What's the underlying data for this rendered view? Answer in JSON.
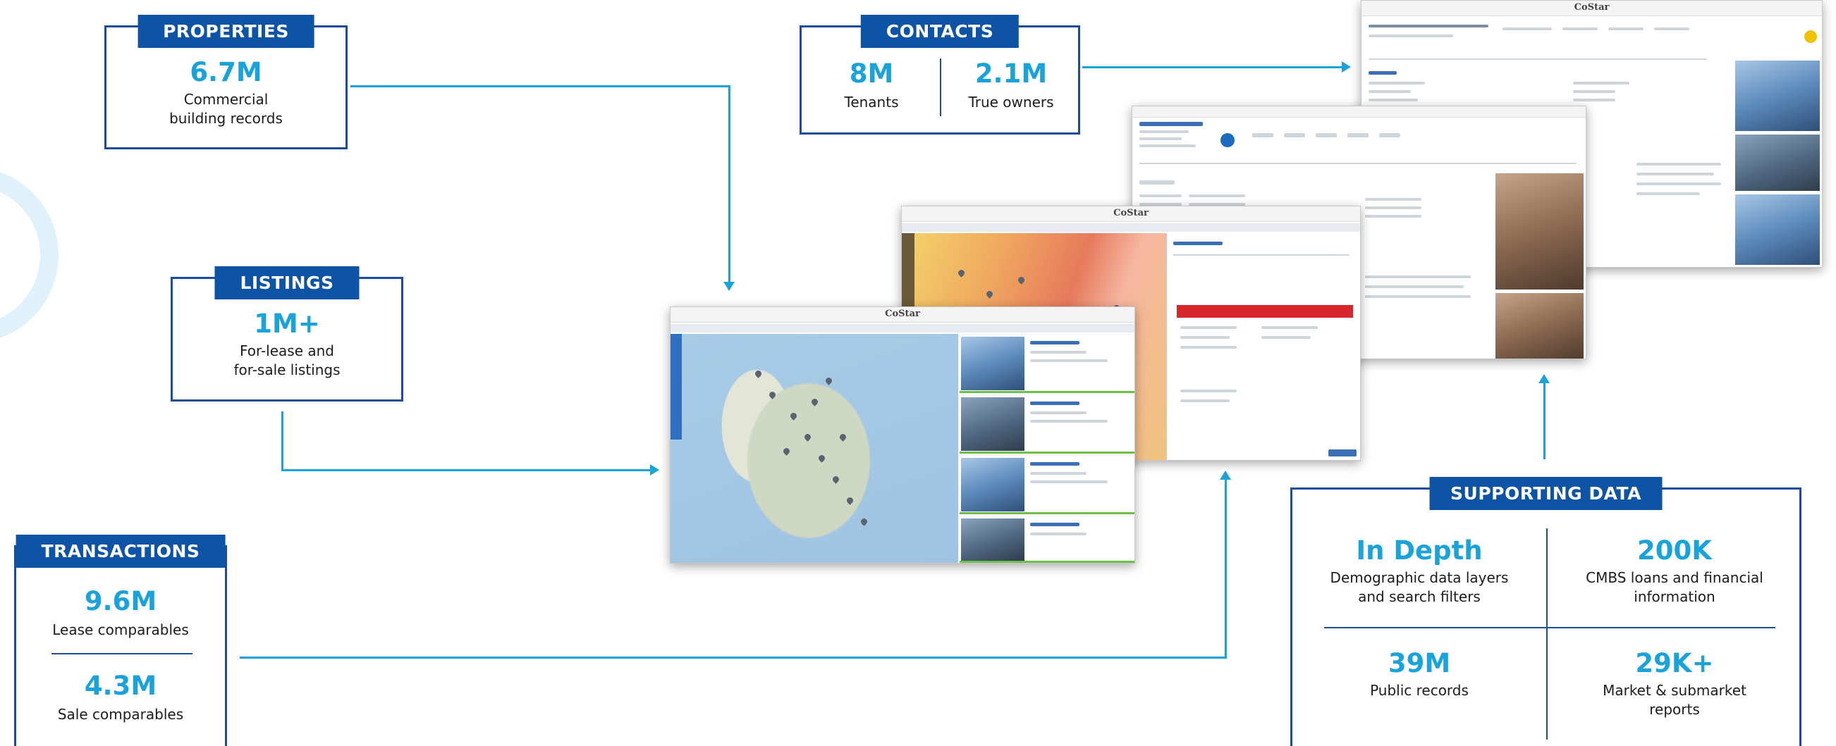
{
  "colors": {
    "tab_bg": "#0d53a6",
    "accent": "#1aa2da",
    "border": "#1b4f9c"
  },
  "properties": {
    "title": "PROPERTIES",
    "value": "6.7M",
    "label": "Commercial\nbuilding records"
  },
  "contacts": {
    "title": "CONTACTS",
    "items": [
      {
        "value": "8M",
        "label": "Tenants"
      },
      {
        "value": "2.1M",
        "label": "True owners"
      }
    ]
  },
  "listings": {
    "title": "LISTINGS",
    "value": "1M+",
    "label": "For-lease and\nfor-sale listings"
  },
  "transactions": {
    "title": "TRANSACTIONS",
    "items": [
      {
        "value": "9.6M",
        "label": "Lease comparables"
      },
      {
        "value": "4.3M",
        "label": "Sale comparables"
      }
    ]
  },
  "supporting": {
    "title": "SUPPORTING DATA",
    "items": [
      {
        "value": "In Depth",
        "label": "Demographic data layers\nand search filters"
      },
      {
        "value": "200K",
        "label": "CMBS loans and financial\ninformation"
      },
      {
        "value": "39M",
        "label": "Public records"
      },
      {
        "value": "29K+",
        "label": "Market & submarket\nreports"
      }
    ]
  },
  "screens": {
    "logo": "CoStar"
  }
}
